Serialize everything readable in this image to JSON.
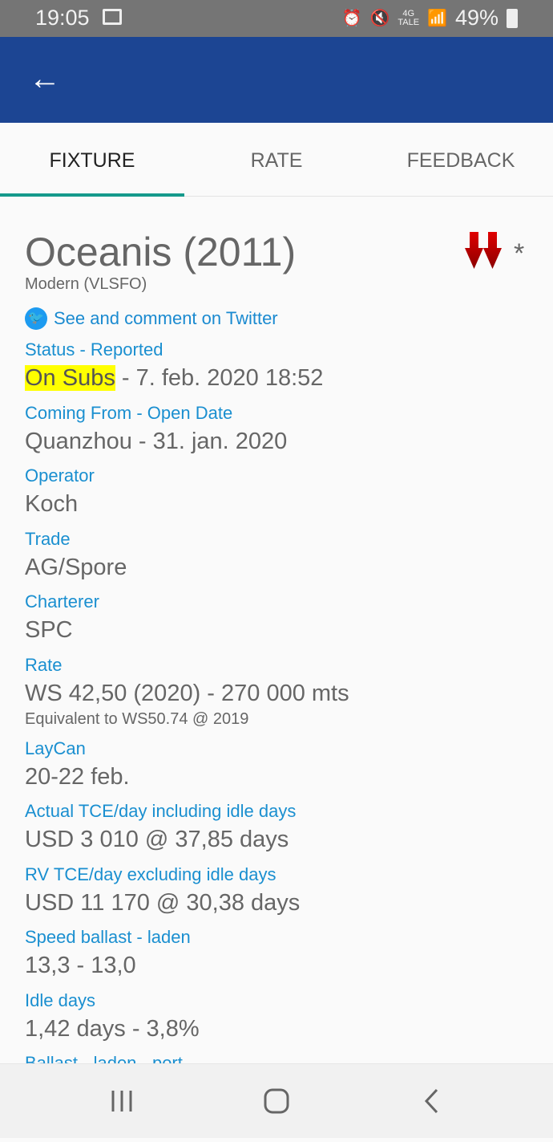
{
  "status_bar": {
    "time": "19:05",
    "network": "4G",
    "network_sub": "TALE",
    "battery": "49%"
  },
  "tabs": [
    {
      "label": "FIXTURE",
      "active": true
    },
    {
      "label": "RATE",
      "active": false
    },
    {
      "label": "FEEDBACK",
      "active": false
    }
  ],
  "vessel": {
    "title": "Oceanis (2011)",
    "subtitle": "Modern (VLSFO)",
    "twitter_link": "See and comment on Twitter",
    "marker": "*"
  },
  "fields": [
    {
      "label": "Status - Reported",
      "value_highlight": "On Subs",
      "value": " - 7. feb. 2020 18:52"
    },
    {
      "label": "Coming From - Open Date",
      "value": "Quanzhou - 31. jan. 2020"
    },
    {
      "label": "Operator",
      "value": "Koch"
    },
    {
      "label": "Trade",
      "value": "AG/Spore"
    },
    {
      "label": "Charterer",
      "value": "SPC"
    },
    {
      "label": "Rate",
      "value": "WS 42,50 (2020) - 270 000 mts",
      "note": "Equivalent to WS50.74 @ 2019"
    },
    {
      "label": "LayCan",
      "value": "20-22 feb."
    },
    {
      "label": "Actual TCE/day including idle days",
      "value": "USD 3 010 @ 37,85 days"
    },
    {
      "label": "RV TCE/day excluding idle days",
      "value": "USD 11 170 @ 30,38 days"
    },
    {
      "label": "Speed ballast - laden",
      "value": "13,3 - 13,0"
    },
    {
      "label": "Idle days",
      "value": "1,42 days - 3,8%"
    },
    {
      "label": "Ballast - laden - port"
    }
  ],
  "colors": {
    "appbar": "#1c4593",
    "label": "#1a8fd0",
    "tab_indicator": "#159a8c",
    "highlight": "#ffff00",
    "arrow": "#c00000"
  }
}
